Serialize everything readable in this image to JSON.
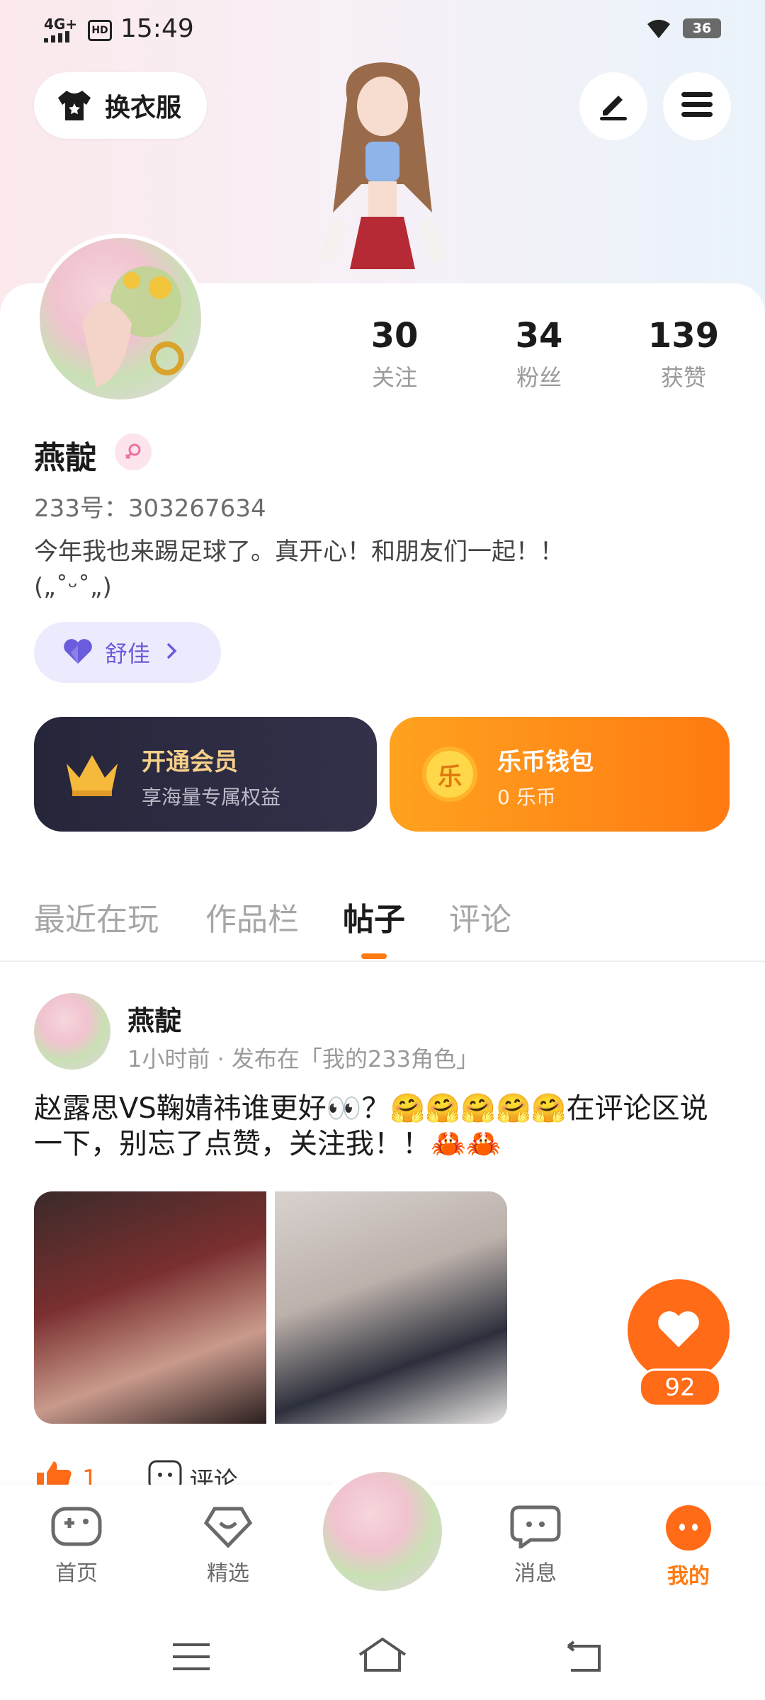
{
  "status": {
    "time": "15:49",
    "network": "4G+",
    "hd": "HD",
    "battery": "36"
  },
  "header": {
    "dress_button": "换衣服"
  },
  "profile": {
    "following": {
      "count": "30",
      "label": "关注"
    },
    "fans": {
      "count": "34",
      "label": "粉丝"
    },
    "likes": {
      "count": "139",
      "label": "获赞"
    },
    "name": "燕靛",
    "uid": "233号：303267634",
    "bio_line1": "今年我也来踢足球了。真开心！和朋友们一起！！",
    "bio_line2": "(„˚ᵕ˚„)",
    "tag_label": "舒佳"
  },
  "cards": {
    "vip": {
      "title": "开通会员",
      "subtitle": "享海量专属权益"
    },
    "wallet": {
      "icon_text": "乐",
      "title": "乐币钱包",
      "subtitle": "0 乐币"
    }
  },
  "tabs": [
    "最近在玩",
    "作品栏",
    "帖子",
    "评论"
  ],
  "post": {
    "author": "燕靛",
    "meta": "1小时前 · 发布在「我的233角色」",
    "text": "赵露思VS鞠婧祎谁更好👀？🤗🤗🤗🤗🤗在评论区说一下，别忘了点赞，关注我！！🦀🦀",
    "like_count": "92",
    "thumb_count": "1",
    "comment_label": "评论"
  },
  "nav": {
    "home": "首页",
    "featured": "精选",
    "messages": "消息",
    "me": "我的"
  },
  "colors": {
    "accent": "#ff7a12",
    "vip_bg": "#26263a",
    "tag_text": "#6a5cdc"
  }
}
